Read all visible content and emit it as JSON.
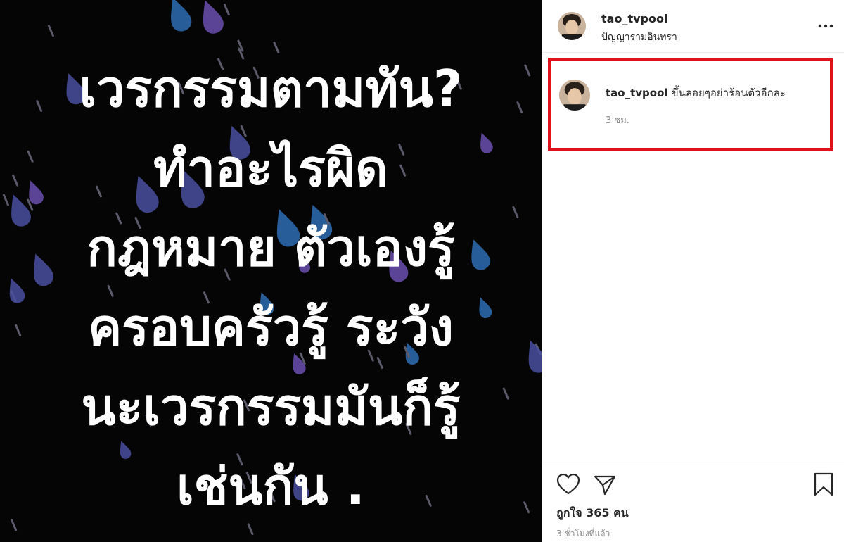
{
  "post": {
    "text_lines": [
      "เวรกรรมตามทัน?",
      "ทำอะไรผิด",
      "กฎหมาย ตัวเองรู้",
      "ครอบครัวรู้ ระวัง",
      "นะเวรกรรมมันก็รู้",
      "เช่นกัน ."
    ],
    "background_color": "#050505",
    "drop_colors": [
      "#4a4fa0",
      "#2e6fb5",
      "#6b4fb0",
      "#5a5a6a"
    ]
  },
  "header": {
    "username": "tao_tvpool",
    "location": "ปัญญารามอินทรา",
    "more_icon": "more-horizontal-icon"
  },
  "comment": {
    "username": "tao_tvpool",
    "text": "ขึ้นลอยๆอย่าร้อนตัวอีกละ",
    "time": "3 ชม.",
    "highlight_color": "#e0121b"
  },
  "actions": {
    "like_icon": "heart-icon",
    "share_icon": "paper-plane-icon",
    "save_icon": "bookmark-icon",
    "likes_text": "ถูกใจ 365 คน",
    "timestamp": "3 ชั่วโมงที่แล้ว"
  }
}
